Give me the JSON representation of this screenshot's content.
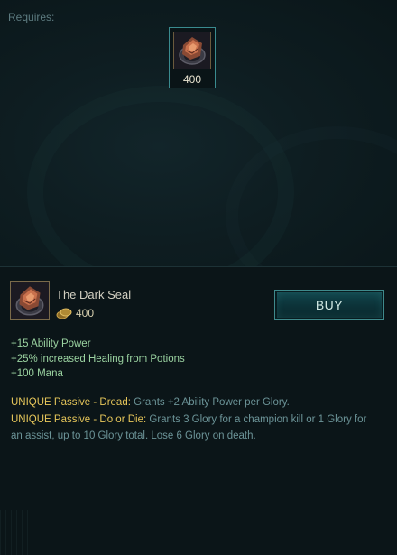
{
  "requires": {
    "label": "Requires:",
    "items": [
      {
        "icon": "dark-seal-icon",
        "price": "400"
      }
    ]
  },
  "item": {
    "icon": "dark-seal-icon",
    "name": "The Dark Seal",
    "price_icon": "gold-coin-icon",
    "price": "400",
    "buy_label": "BUY",
    "stats": [
      "+15 Ability Power",
      "+25% increased Healing from Potions",
      "+100 Mana"
    ],
    "passives": [
      {
        "label": "UNIQUE Passive - Dread:",
        "text": " Grants +2 Ability Power per Glory."
      },
      {
        "label": "UNIQUE Passive - Do or Die:",
        "text": " Grants 3 Glory for a champion kill or 1 Glory for an assist, up to 10 Glory total. Lose 6 Glory on death."
      }
    ]
  },
  "colors": {
    "accent": "#3f8a8c",
    "stat_green": "#9bd3a1",
    "passive_gold": "#e6c65a",
    "passive_text": "#6c9498"
  }
}
